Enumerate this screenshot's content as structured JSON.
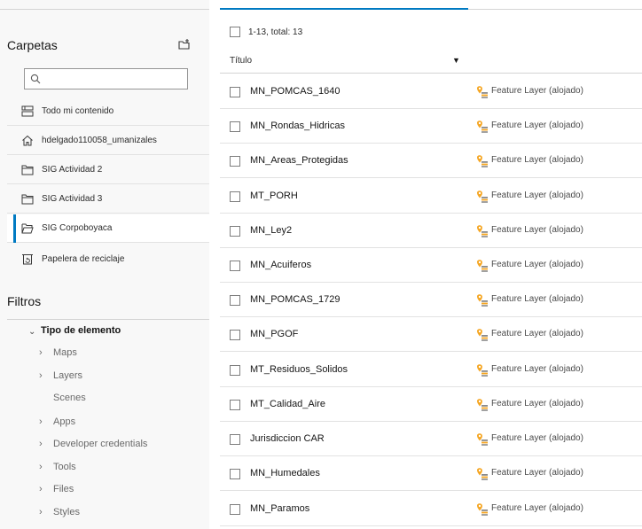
{
  "sidebar": {
    "folders_title": "Carpetas",
    "search_placeholder": "",
    "folders": [
      {
        "label": "Todo mi contenido",
        "icon": "all-content-icon"
      },
      {
        "label": "hdelgado110058_umanizales",
        "icon": "home-icon"
      },
      {
        "label": "SIG Actividad 2",
        "icon": "folder-icon"
      },
      {
        "label": "SIG Actividad 3",
        "icon": "folder-icon"
      },
      {
        "label": "SIG Corpoboyaca",
        "icon": "folder-open-icon",
        "active": true
      },
      {
        "label": "Papelera de reciclaje",
        "icon": "recycle-bin-icon"
      }
    ],
    "filters_title": "Filtros",
    "item_type_label": "Tipo de elemento",
    "item_types": [
      {
        "label": "Maps",
        "expandable": true
      },
      {
        "label": "Layers",
        "expandable": true
      },
      {
        "label": "Scenes",
        "expandable": false
      },
      {
        "label": "Apps",
        "expandable": true
      },
      {
        "label": "Developer credentials",
        "expandable": true
      },
      {
        "label": "Tools",
        "expandable": true
      },
      {
        "label": "Files",
        "expandable": true
      },
      {
        "label": "Styles",
        "expandable": true
      }
    ]
  },
  "main": {
    "count_text": "1-13, total: 13",
    "column_title": "Título",
    "rows": [
      {
        "title": "MN_POMCAS_1640",
        "type": "Feature Layer (alojado)"
      },
      {
        "title": "MN_Rondas_Hidricas",
        "type": "Feature Layer (alojado)"
      },
      {
        "title": "MN_Areas_Protegidas",
        "type": "Feature Layer (alojado)"
      },
      {
        "title": "MT_PORH",
        "type": "Feature Layer (alojado)"
      },
      {
        "title": "MN_Ley2",
        "type": "Feature Layer (alojado)"
      },
      {
        "title": "MN_Acuiferos",
        "type": "Feature Layer (alojado)"
      },
      {
        "title": "MN_POMCAS_1729",
        "type": "Feature Layer (alojado)"
      },
      {
        "title": "MN_PGOF",
        "type": "Feature Layer (alojado)"
      },
      {
        "title": "MT_Residuos_Solidos",
        "type": "Feature Layer (alojado)"
      },
      {
        "title": "MT_Calidad_Aire",
        "type": "Feature Layer (alojado)"
      },
      {
        "title": "Jurisdiccion CAR",
        "type": "Feature Layer (alojado)"
      },
      {
        "title": "MN_Humedales",
        "type": "Feature Layer (alojado)"
      },
      {
        "title": "MN_Paramos",
        "type": "Feature Layer (alojado)"
      }
    ]
  },
  "colors": {
    "accent": "#007ac2",
    "layer_icon_orange": "#f5a623"
  }
}
